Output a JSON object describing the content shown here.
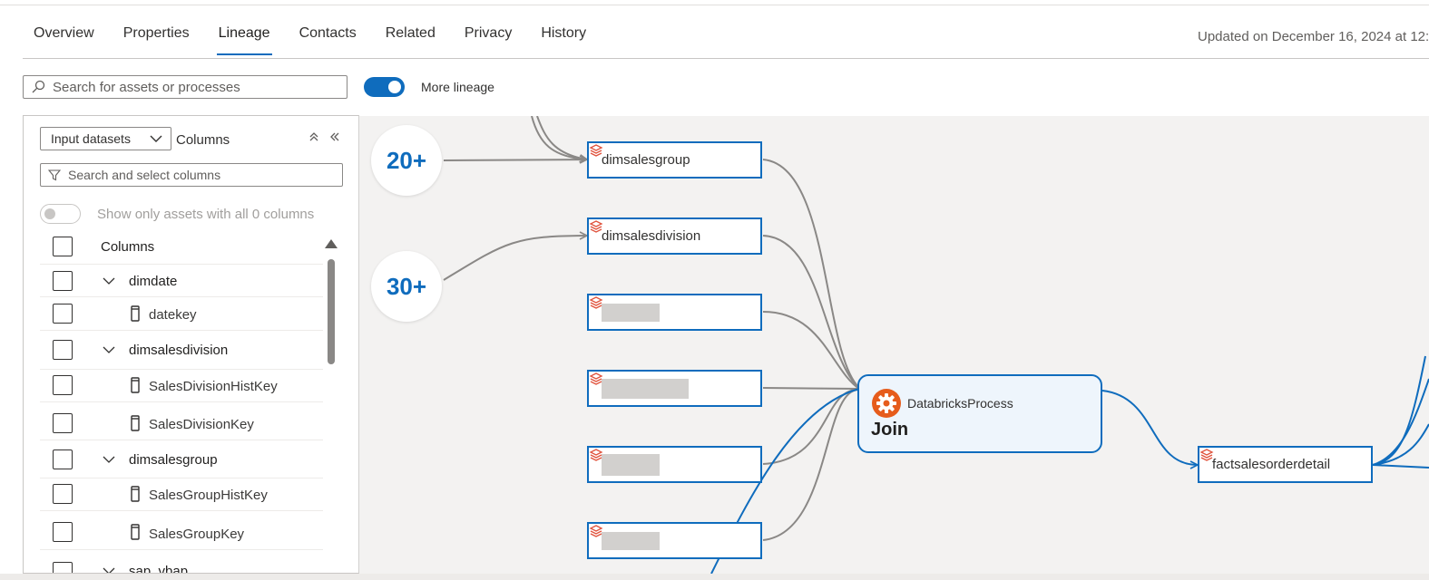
{
  "tabs": [
    {
      "label": "Overview",
      "active": false
    },
    {
      "label": "Properties",
      "active": false
    },
    {
      "label": "Lineage",
      "active": true
    },
    {
      "label": "Contacts",
      "active": false
    },
    {
      "label": "Related",
      "active": false
    },
    {
      "label": "Privacy",
      "active": false
    },
    {
      "label": "History",
      "active": false
    }
  ],
  "updated_text": "Updated on December 16, 2024 at 12:3",
  "search": {
    "placeholder": "Search for assets or processes",
    "value": ""
  },
  "more_lineage": {
    "label": "More lineage",
    "enabled": true
  },
  "panel": {
    "dropdown_value": "Input datasets",
    "columns_label": "Columns",
    "column_search_placeholder": "Search and select columns",
    "show_only_label": "Show only assets with all 0 columns",
    "show_only_enabled": false,
    "header_label": "Columns",
    "rows": [
      {
        "type": "group",
        "label": "dimdate"
      },
      {
        "type": "column",
        "label": "datekey"
      },
      {
        "type": "group",
        "label": "dimsalesdivision"
      },
      {
        "type": "column",
        "label": "SalesDivisionHistKey"
      },
      {
        "type": "column",
        "label": "SalesDivisionKey"
      },
      {
        "type": "group",
        "label": "dimsalesgroup"
      },
      {
        "type": "column",
        "label": "SalesGroupHistKey"
      },
      {
        "type": "column",
        "label": "SalesGroupKey"
      },
      {
        "type": "group",
        "label": "sap_vbap"
      }
    ]
  },
  "canvas": {
    "bubbles": [
      "20+",
      "30+"
    ],
    "inputs": [
      "dimsalesgroup",
      "dimsalesdivision",
      "",
      "",
      "",
      ""
    ],
    "process": {
      "type": "DatabricksProcess",
      "name": "Join"
    },
    "output": "factsalesorderdetail"
  },
  "colors": {
    "accent": "#0f6cbd",
    "process_icon": "#e65c1c",
    "dataset_icon": "#e0533d",
    "edge_gray": "#8a8886"
  }
}
